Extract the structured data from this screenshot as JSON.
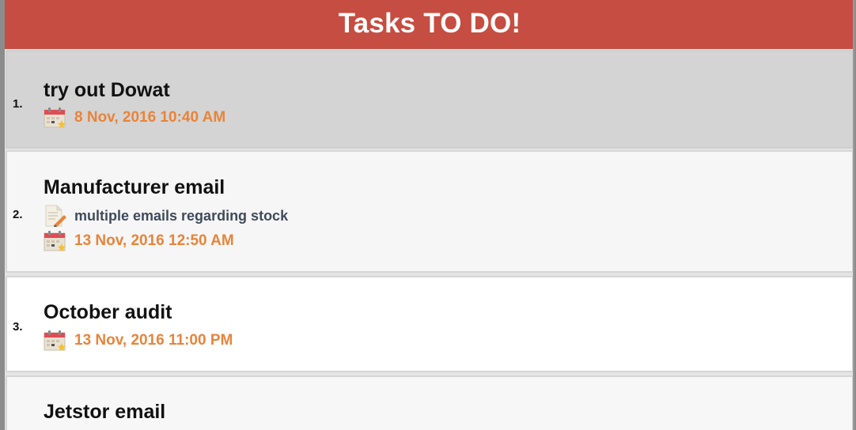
{
  "header": {
    "title": "Tasks TO DO!"
  },
  "tasks": [
    {
      "number": "1.",
      "title": "try out Dowat",
      "note": "",
      "date": "8 Nov, 2016 10:40 AM",
      "selected": true
    },
    {
      "number": "2.",
      "title": "Manufacturer email",
      "note": "multiple emails regarding stock",
      "date": "13 Nov, 2016 12:50 AM",
      "selected": false
    },
    {
      "number": "3.",
      "title": "October audit",
      "note": "",
      "date": "13 Nov, 2016 11:00 PM",
      "selected": false
    },
    {
      "number": "",
      "title": "Jetstor email",
      "note": "",
      "date": "",
      "selected": false
    }
  ],
  "icons": {
    "date": "calendar-icon",
    "note": "note-icon"
  },
  "colors": {
    "header": "#c64d41",
    "date": "#e8843a",
    "note": "#3f4a5c",
    "selected_row": "#d4d4d4"
  }
}
